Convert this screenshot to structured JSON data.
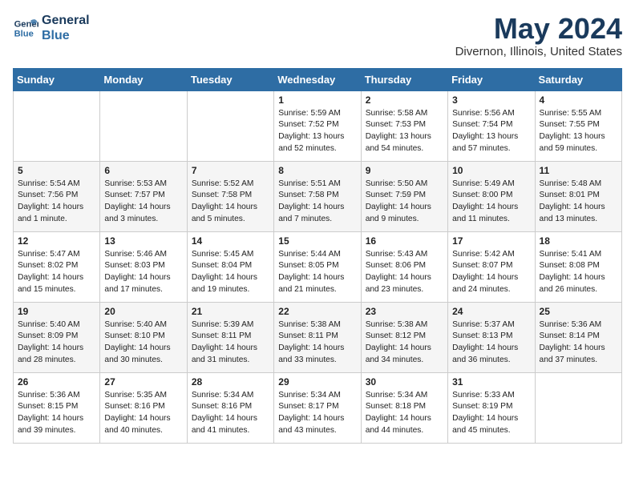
{
  "logo": {
    "line1": "General",
    "line2": "Blue"
  },
  "title": "May 2024",
  "subtitle": "Divernon, Illinois, United States",
  "weekdays": [
    "Sunday",
    "Monday",
    "Tuesday",
    "Wednesday",
    "Thursday",
    "Friday",
    "Saturday"
  ],
  "weeks": [
    [
      {
        "day": "",
        "content": ""
      },
      {
        "day": "",
        "content": ""
      },
      {
        "day": "",
        "content": ""
      },
      {
        "day": "1",
        "content": "Sunrise: 5:59 AM\nSunset: 7:52 PM\nDaylight: 13 hours\nand 52 minutes."
      },
      {
        "day": "2",
        "content": "Sunrise: 5:58 AM\nSunset: 7:53 PM\nDaylight: 13 hours\nand 54 minutes."
      },
      {
        "day": "3",
        "content": "Sunrise: 5:56 AM\nSunset: 7:54 PM\nDaylight: 13 hours\nand 57 minutes."
      },
      {
        "day": "4",
        "content": "Sunrise: 5:55 AM\nSunset: 7:55 PM\nDaylight: 13 hours\nand 59 minutes."
      }
    ],
    [
      {
        "day": "5",
        "content": "Sunrise: 5:54 AM\nSunset: 7:56 PM\nDaylight: 14 hours\nand 1 minute."
      },
      {
        "day": "6",
        "content": "Sunrise: 5:53 AM\nSunset: 7:57 PM\nDaylight: 14 hours\nand 3 minutes."
      },
      {
        "day": "7",
        "content": "Sunrise: 5:52 AM\nSunset: 7:58 PM\nDaylight: 14 hours\nand 5 minutes."
      },
      {
        "day": "8",
        "content": "Sunrise: 5:51 AM\nSunset: 7:58 PM\nDaylight: 14 hours\nand 7 minutes."
      },
      {
        "day": "9",
        "content": "Sunrise: 5:50 AM\nSunset: 7:59 PM\nDaylight: 14 hours\nand 9 minutes."
      },
      {
        "day": "10",
        "content": "Sunrise: 5:49 AM\nSunset: 8:00 PM\nDaylight: 14 hours\nand 11 minutes."
      },
      {
        "day": "11",
        "content": "Sunrise: 5:48 AM\nSunset: 8:01 PM\nDaylight: 14 hours\nand 13 minutes."
      }
    ],
    [
      {
        "day": "12",
        "content": "Sunrise: 5:47 AM\nSunset: 8:02 PM\nDaylight: 14 hours\nand 15 minutes."
      },
      {
        "day": "13",
        "content": "Sunrise: 5:46 AM\nSunset: 8:03 PM\nDaylight: 14 hours\nand 17 minutes."
      },
      {
        "day": "14",
        "content": "Sunrise: 5:45 AM\nSunset: 8:04 PM\nDaylight: 14 hours\nand 19 minutes."
      },
      {
        "day": "15",
        "content": "Sunrise: 5:44 AM\nSunset: 8:05 PM\nDaylight: 14 hours\nand 21 minutes."
      },
      {
        "day": "16",
        "content": "Sunrise: 5:43 AM\nSunset: 8:06 PM\nDaylight: 14 hours\nand 23 minutes."
      },
      {
        "day": "17",
        "content": "Sunrise: 5:42 AM\nSunset: 8:07 PM\nDaylight: 14 hours\nand 24 minutes."
      },
      {
        "day": "18",
        "content": "Sunrise: 5:41 AM\nSunset: 8:08 PM\nDaylight: 14 hours\nand 26 minutes."
      }
    ],
    [
      {
        "day": "19",
        "content": "Sunrise: 5:40 AM\nSunset: 8:09 PM\nDaylight: 14 hours\nand 28 minutes."
      },
      {
        "day": "20",
        "content": "Sunrise: 5:40 AM\nSunset: 8:10 PM\nDaylight: 14 hours\nand 30 minutes."
      },
      {
        "day": "21",
        "content": "Sunrise: 5:39 AM\nSunset: 8:11 PM\nDaylight: 14 hours\nand 31 minutes."
      },
      {
        "day": "22",
        "content": "Sunrise: 5:38 AM\nSunset: 8:11 PM\nDaylight: 14 hours\nand 33 minutes."
      },
      {
        "day": "23",
        "content": "Sunrise: 5:38 AM\nSunset: 8:12 PM\nDaylight: 14 hours\nand 34 minutes."
      },
      {
        "day": "24",
        "content": "Sunrise: 5:37 AM\nSunset: 8:13 PM\nDaylight: 14 hours\nand 36 minutes."
      },
      {
        "day": "25",
        "content": "Sunrise: 5:36 AM\nSunset: 8:14 PM\nDaylight: 14 hours\nand 37 minutes."
      }
    ],
    [
      {
        "day": "26",
        "content": "Sunrise: 5:36 AM\nSunset: 8:15 PM\nDaylight: 14 hours\nand 39 minutes."
      },
      {
        "day": "27",
        "content": "Sunrise: 5:35 AM\nSunset: 8:16 PM\nDaylight: 14 hours\nand 40 minutes."
      },
      {
        "day": "28",
        "content": "Sunrise: 5:34 AM\nSunset: 8:16 PM\nDaylight: 14 hours\nand 41 minutes."
      },
      {
        "day": "29",
        "content": "Sunrise: 5:34 AM\nSunset: 8:17 PM\nDaylight: 14 hours\nand 43 minutes."
      },
      {
        "day": "30",
        "content": "Sunrise: 5:34 AM\nSunset: 8:18 PM\nDaylight: 14 hours\nand 44 minutes."
      },
      {
        "day": "31",
        "content": "Sunrise: 5:33 AM\nSunset: 8:19 PM\nDaylight: 14 hours\nand 45 minutes."
      },
      {
        "day": "",
        "content": ""
      }
    ]
  ]
}
